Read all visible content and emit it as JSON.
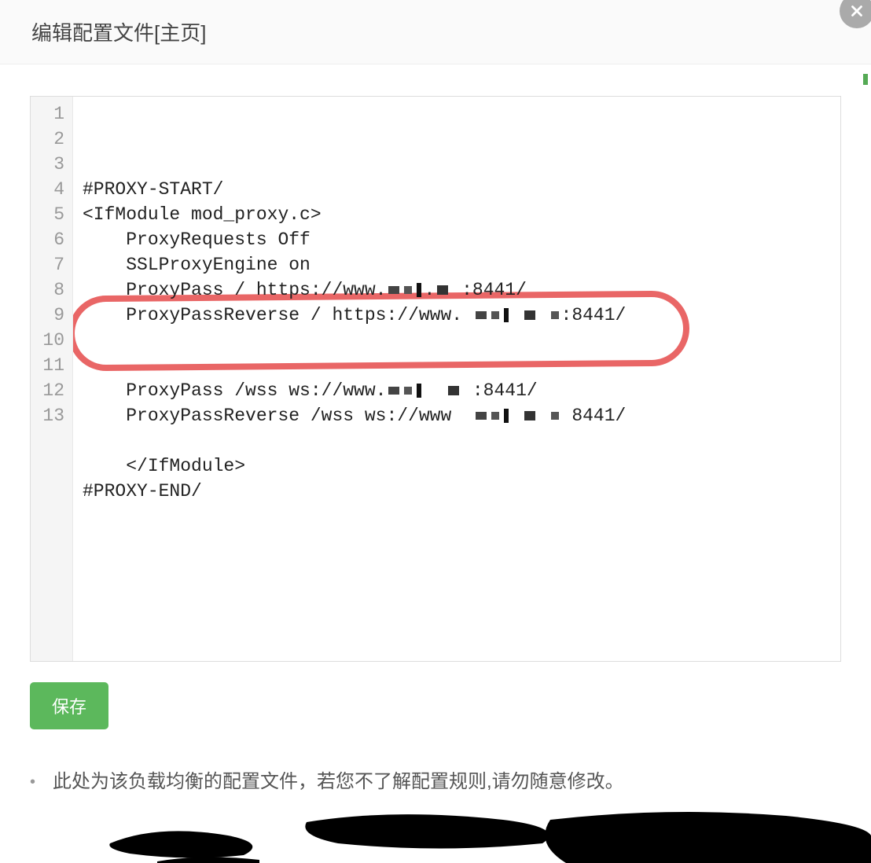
{
  "header": {
    "title": "编辑配置文件[主页]"
  },
  "editor": {
    "line_count": 13,
    "lines": [
      "#PROXY-START/",
      "<IfModule mod_proxy.c>",
      "    ProxyRequests Off",
      "    SSLProxyEngine on",
      "    ProxyPass / https://www.███.█ :8441/",
      "    ProxyPassReverse / https://www. ███ █ █:8441/",
      "",
      "",
      "    ProxyPass /wss ws://www.███  █ :8441/",
      "    ProxyPassReverse /wss ws://www  ███ █ █ 8441/",
      "",
      "    </IfModule>",
      "#PROXY-END/"
    ],
    "highlighted_lines": [
      9,
      10
    ]
  },
  "buttons": {
    "save_label": "保存"
  },
  "notes": {
    "item1": "此处为该负载均衡的配置文件，若您不了解配置规则,请勿随意修改。"
  }
}
